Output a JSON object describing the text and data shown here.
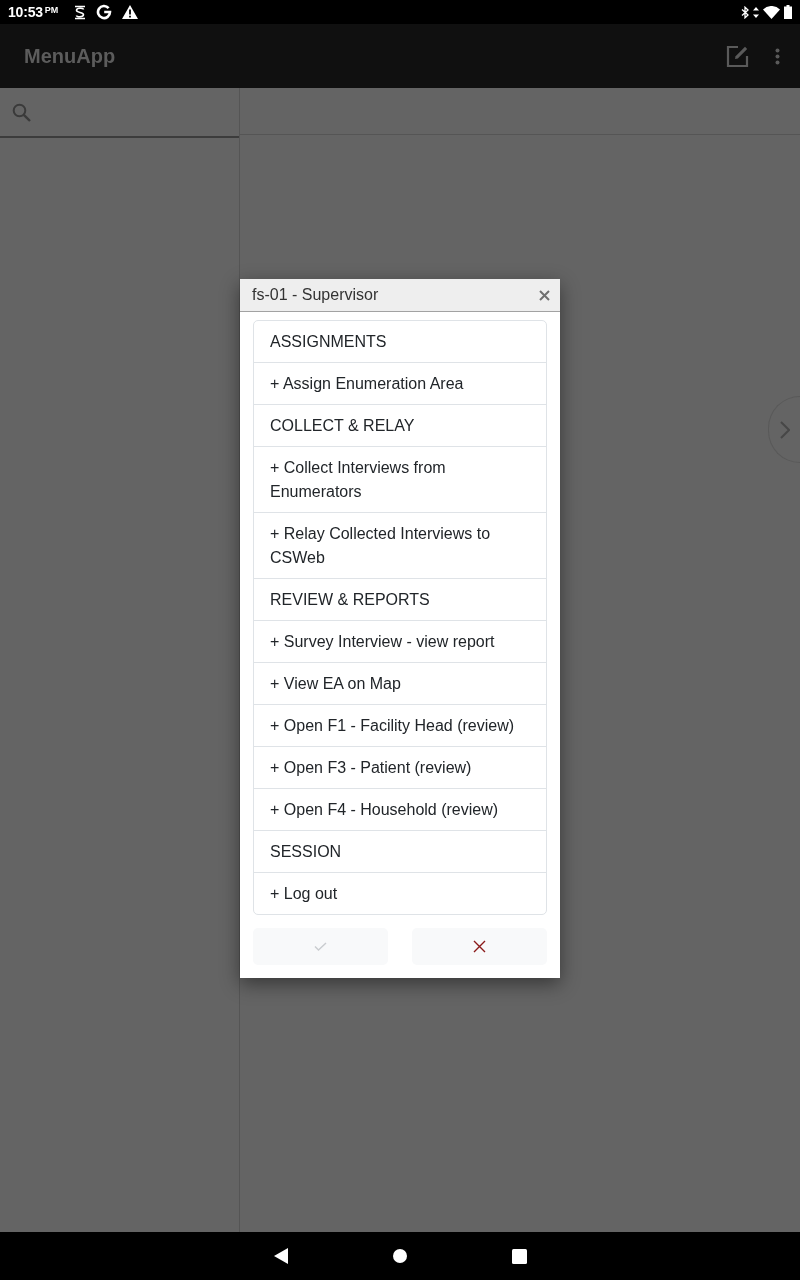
{
  "status_bar": {
    "time": "10:53",
    "meridiem": "PM"
  },
  "app_bar": {
    "title": "MenuApp"
  },
  "dialog": {
    "title": "fs-01 - Supervisor",
    "items": [
      {
        "label": "ASSIGNMENTS"
      },
      {
        "label": "+ Assign Enumeration Area"
      },
      {
        "label": "COLLECT & RELAY"
      },
      {
        "label": "+ Collect Interviews from Enumerators"
      },
      {
        "label": "+ Relay Collected Interviews to CSWeb"
      },
      {
        "label": "REVIEW & REPORTS"
      },
      {
        "label": "+ Survey Interview - view report"
      },
      {
        "label": "+ View EA on Map"
      },
      {
        "label": "+ Open F1 - Facility Head (review)"
      },
      {
        "label": "+ Open F3 - Patient (review)"
      },
      {
        "label": "+ Open F4 - Household (review)"
      },
      {
        "label": "SESSION"
      },
      {
        "label": "+ Log out"
      }
    ],
    "buttons": [
      {
        "kind": "confirm",
        "disabled": true
      },
      {
        "kind": "cancel",
        "disabled": false
      }
    ]
  }
}
